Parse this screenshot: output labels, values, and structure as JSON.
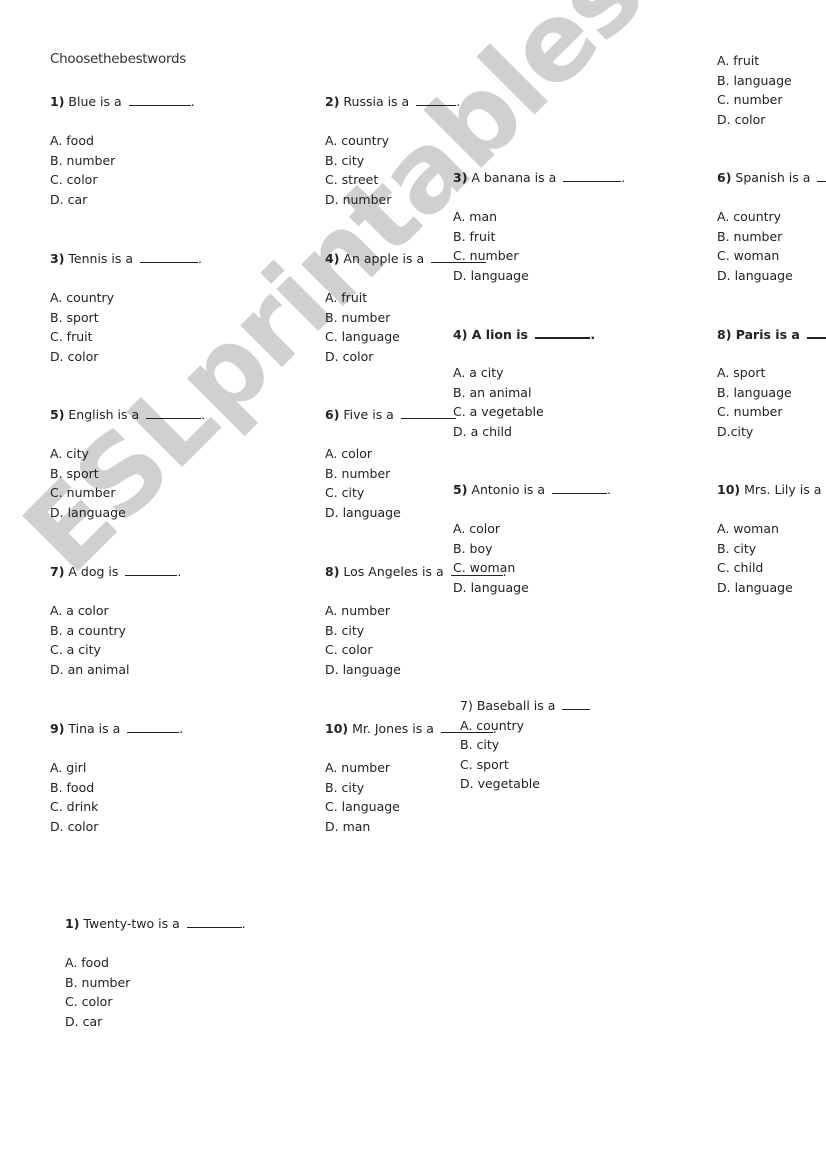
{
  "worksheet": {
    "title": "Choosethebestwords",
    "watermark": "ESLprintables.com",
    "questions": [
      {
        "num": "1)",
        "text": "Blue is a",
        "end": ".",
        "options": [
          "A. food",
          "B. number",
          "C. color",
          "D. car"
        ]
      },
      {
        "num": "2)",
        "text": "Russia is a",
        "end": ".",
        "options": [
          "A. country",
          "B. city",
          "C. street",
          "D. number"
        ]
      },
      {
        "num": "",
        "text": "",
        "end": "",
        "options": [
          "A. fruit",
          "B. language",
          "C. number",
          "D. color"
        ]
      },
      {
        "num": "3)",
        "text": "A banana is a",
        "end": ".",
        "options": [
          "A. man",
          "B. fruit",
          "C. number",
          "D. language"
        ]
      },
      {
        "num": "6)",
        "text": "Spanish is a",
        "end": "",
        "options": [
          "A. country",
          "B. number",
          "C. woman",
          "D. language"
        ]
      },
      {
        "num": "3)",
        "text": "Tennis is a",
        "end": ".",
        "options": [
          "A. country",
          "B. sport",
          "C. fruit",
          "D. color"
        ]
      },
      {
        "num": "4)",
        "text": "An apple is a",
        "end": "",
        "options": [
          "A. fruit",
          "B. number",
          "C. language",
          "D. color"
        ]
      },
      {
        "num": "4)",
        "text": "A lion is",
        "end": ".",
        "options": [
          "A. a city",
          "B. an animal",
          "C. a vegetable",
          "D. a child"
        ]
      },
      {
        "num": "8)",
        "text": "Paris is a",
        "end": "",
        "options": [
          "A. sport",
          "B. language",
          "C. number",
          "D.city"
        ]
      },
      {
        "num": "5)",
        "text": "English is a",
        "end": ".",
        "options": [
          "A. city",
          "B. sport",
          "C. number",
          "D. language"
        ]
      },
      {
        "num": "6)",
        "text": "Five is a",
        "end": "",
        "options": [
          "A. color",
          "B. number",
          "C. city",
          "D. language"
        ]
      },
      {
        "num": "5)",
        "text": "Antonio is a",
        "end": ".",
        "options": [
          "A. color",
          "B. boy",
          "C. woman",
          "D. language"
        ]
      },
      {
        "num": "10)",
        "text": "Mrs. Lily is a",
        "end": "",
        "options": [
          "A. woman",
          "B. city",
          "C. child",
          "D. language"
        ]
      },
      {
        "num": "7)",
        "text": "A dog is",
        "end": ".",
        "options": [
          "A. a color",
          "B. a country",
          "C. a city",
          "D. an animal"
        ]
      },
      {
        "num": "8)",
        "text": "Los Angeles is a",
        "end": ".",
        "options": [
          "A. number",
          "B. city",
          "C. color",
          "D. language"
        ]
      },
      {
        "num": "7)",
        "text": "Baseball is a",
        "end": "",
        "options": [
          "A. country",
          "B. city",
          "C. sport",
          "D. vegetable"
        ]
      },
      {
        "num": "9)",
        "text": "Tina is a",
        "end": ".",
        "options": [
          "A. girl",
          "B. food",
          "C. drink",
          "D. color"
        ]
      },
      {
        "num": "10)",
        "text": "Mr. Jones is a",
        "end": ".",
        "options": [
          "A. number",
          "B. city",
          "C. language",
          "D. man"
        ]
      },
      {
        "num": "1)",
        "text": "Twenty-two is a",
        "end": ".",
        "options": [
          "A. food",
          "B. number",
          "C. color",
          "D. car"
        ]
      }
    ]
  }
}
